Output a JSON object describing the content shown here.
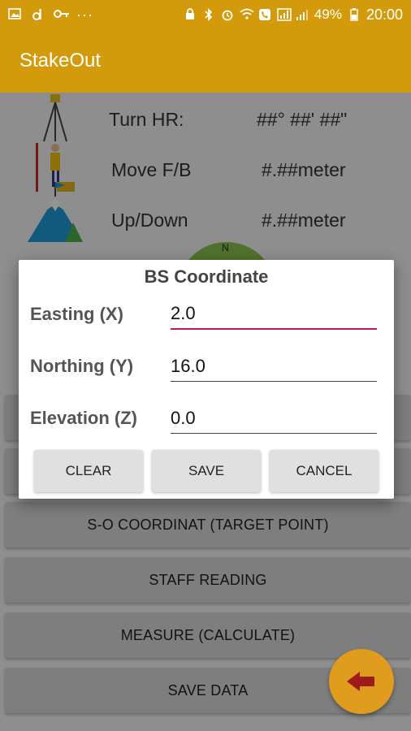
{
  "status_bar": {
    "left_icons": [
      "gallery-icon",
      "d-app-icon",
      "key-icon",
      "more-dots-icon"
    ],
    "more_glyph": "···",
    "right_icons": [
      "lock-icon",
      "bluetooth-icon",
      "alarm-icon",
      "wifi-icon",
      "call-icon",
      "lte-icon",
      "signal-icon",
      "battery-icon"
    ],
    "battery": "49%",
    "time": "20:00"
  },
  "app_bar": {
    "title": "StakeOut"
  },
  "readings": {
    "turn_hr_label": "Turn HR:",
    "turn_hr_value": "##° ##' ##\"",
    "move_fb_label": "Move F/B",
    "move_fb_value": "#.##meter",
    "up_down_label": "Up/Down",
    "up_down_value": "#.##meter"
  },
  "compass": {
    "north_label": "N"
  },
  "buttons": {
    "so_coordinate": "S-O COORDINAT (TARGET POINT)",
    "staff_reading": "STAFF READING",
    "measure": "MEASURE (CALCULATE)",
    "save_data": "SAVE DATA"
  },
  "dialog": {
    "title": "BS Coordinate",
    "easting_label": "Easting (X)",
    "easting_value": "2.0",
    "northing_label": "Northing (Y)",
    "northing_value": "16.0",
    "elevation_label": "Elevation (Z)",
    "elevation_value": "0.0",
    "clear_label": "CLEAR",
    "save_label": "SAVE",
    "cancel_label": "CANCEL"
  },
  "colors": {
    "app_bar": "#d39a0c",
    "fab": "#e09c1c",
    "input_focus": "#c2185b"
  }
}
